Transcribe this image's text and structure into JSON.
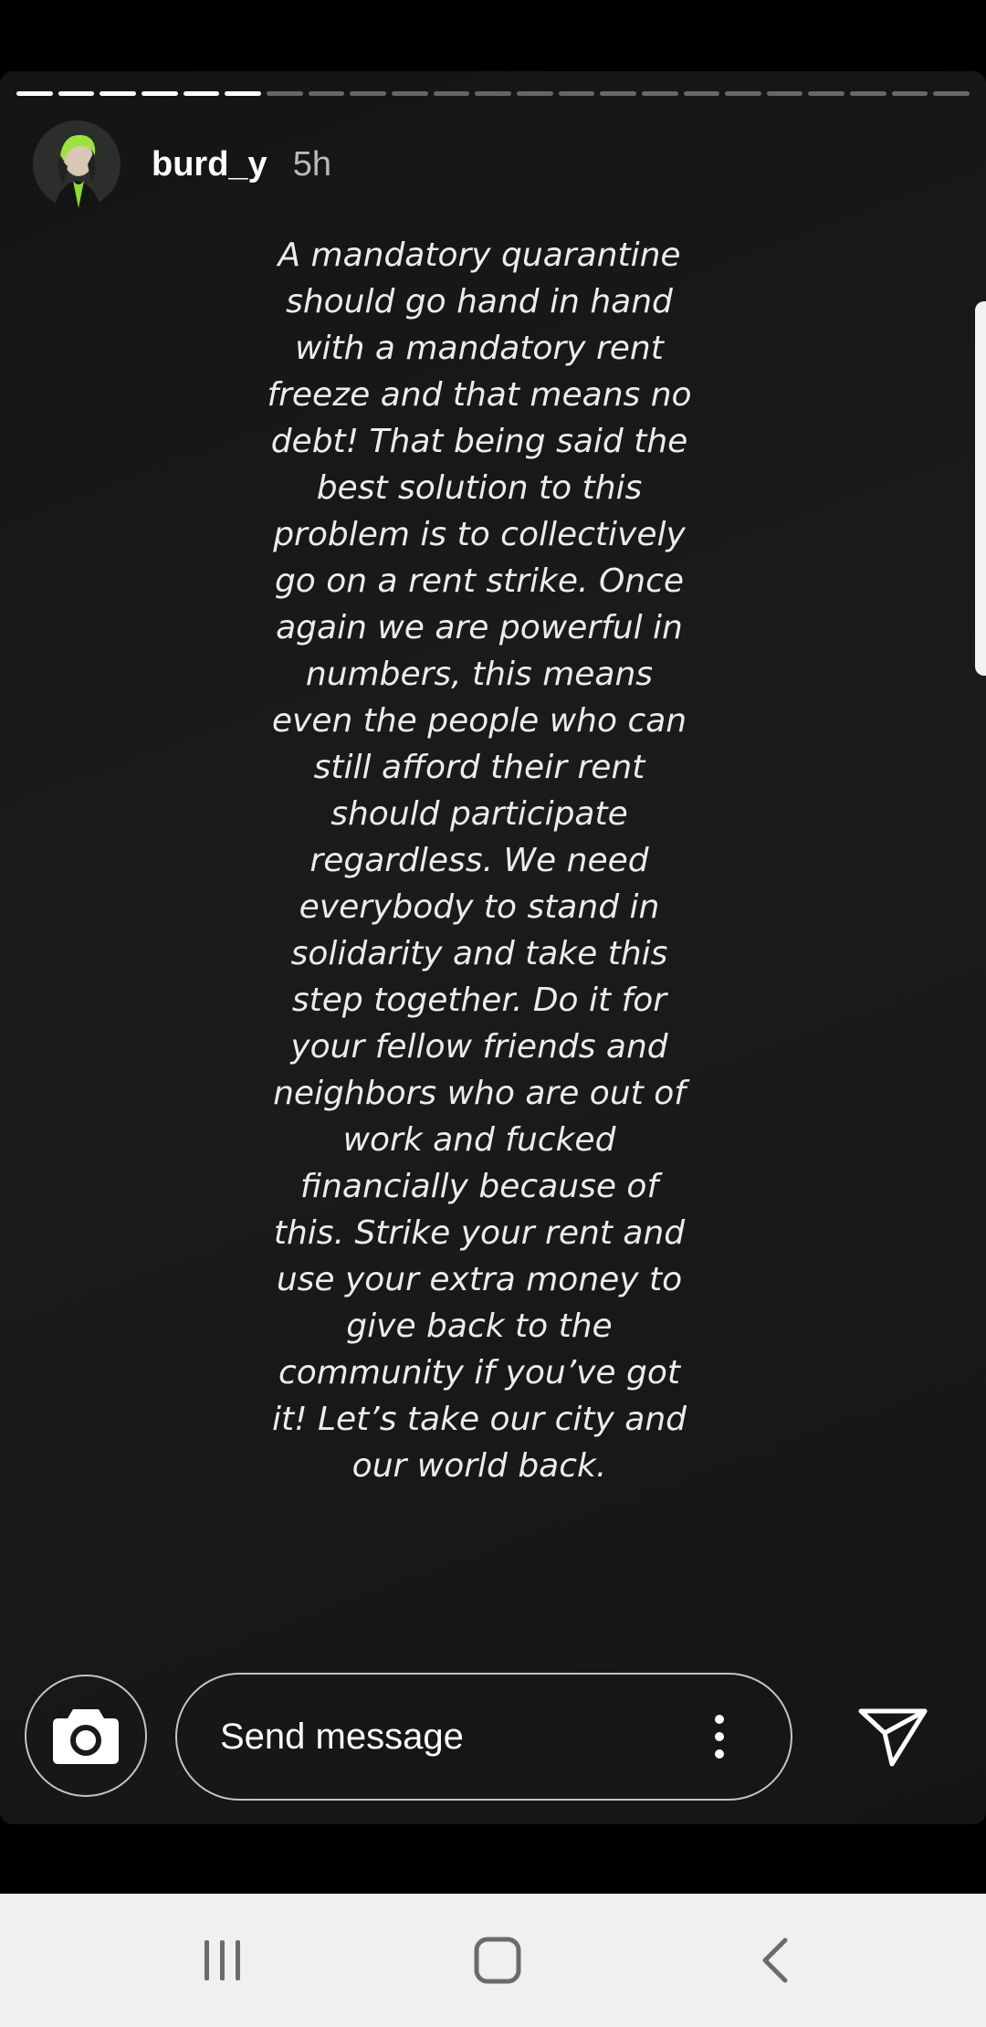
{
  "story": {
    "username": "burd_y",
    "time_ago": "5h",
    "progress": {
      "segments": 23,
      "completed": 6
    },
    "text": "A mandatory quarantine\nshould go hand in hand\nwith a mandatory rent\nfreeze and that means no\ndebt! That being said the\nbest solution to this\nproblem is to collectively\ngo on a rent strike. Once\nagain we are powerful in\nnumbers, this means\neven the people who can\nstill afford their rent\nshould participate\nregardless. We need\neverybody to stand in\nsolidarity and take this\nstep together. Do it for\nyour fellow friends and\nneighbors who are out of\nwork and fucked\nfinancially because of\nthis. Strike your rent and\nuse your extra money to\ngive back to the\ncommunity if you’ve got\nit! Let’s take our city and\nour world back."
  },
  "reply_bar": {
    "placeholder": "Send message",
    "camera_icon": "camera-icon",
    "more_icon": "more-vertical-icon",
    "send_icon": "send-icon"
  },
  "nav_bar": {
    "recents_icon": "recents-icon",
    "home_icon": "home-icon",
    "back_icon": "back-icon"
  },
  "colors": {
    "story_background": "#181818",
    "text": "#ececec",
    "nav_background": "#f0f0f0",
    "nav_icons": "#6b6b6b"
  }
}
